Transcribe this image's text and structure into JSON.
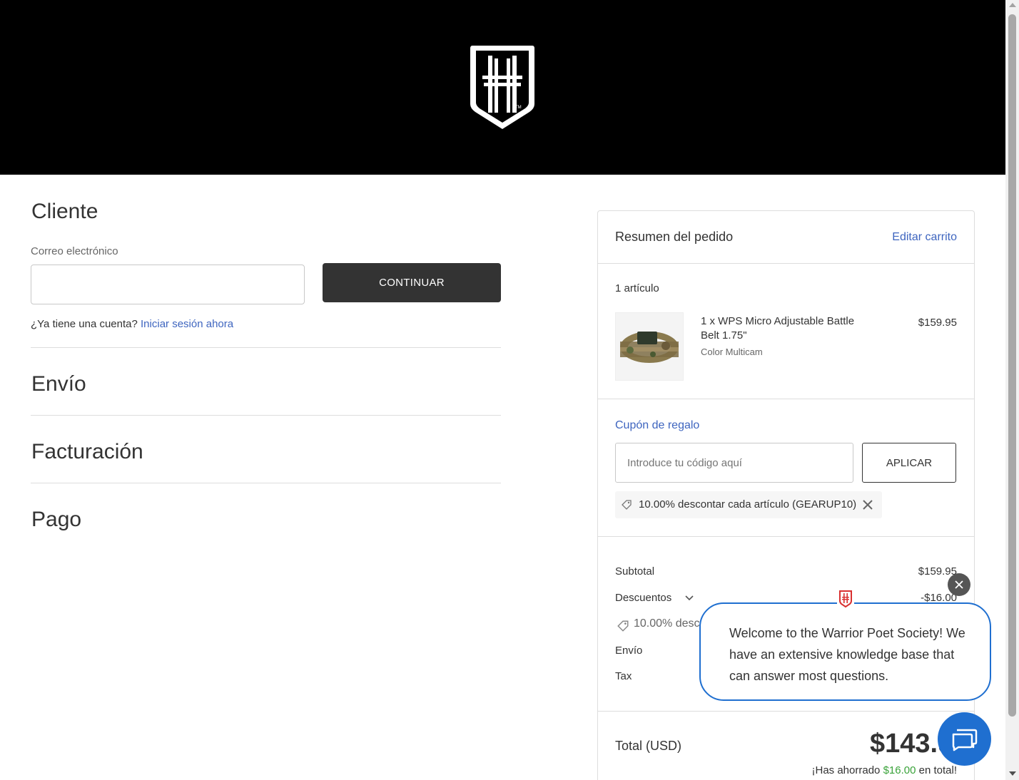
{
  "header": {
    "logo": "warrior-poet-shield-logo"
  },
  "customer": {
    "title": "Cliente",
    "email_label": "Correo electrónico",
    "email_value": "",
    "continue_label": "CONTINUAR",
    "account_question": "¿Ya tiene una cuenta?",
    "signin_link": "Iniciar sesión ahora"
  },
  "sections": {
    "shipping": "Envío",
    "billing": "Facturación",
    "payment": "Pago"
  },
  "summary": {
    "title": "Resumen del pedido",
    "edit_cart": "Editar carrito",
    "items_count": "1 artículo",
    "product": {
      "name": "1 x WPS Micro Adjustable Battle Belt 1.75\"",
      "option": "Color Multicam",
      "price": "$159.95"
    },
    "coupon": {
      "link": "Cupón de regalo",
      "placeholder": "Introduce tu código aquí",
      "apply_label": "APLICAR",
      "applied": "10.00% descontar cada artículo (GEARUP10)"
    },
    "subtotal_label": "Subtotal",
    "subtotal_value": "$159.95",
    "discounts_label": "Descuentos",
    "discounts_value": "-$16.00",
    "discount_line": "10.00% desc",
    "shipping_label": "Envío",
    "tax_label": "Tax",
    "total_label": "Total (USD)",
    "total_value": "$143.9",
    "saved_prefix": "¡Has ahorrado",
    "saved_amount": "$16.00",
    "saved_suffix": "en total!"
  },
  "chat": {
    "message": "Welcome to the Warrior Poet Society! We have an extensive knowledge base that can answer most questions.",
    "close_icon": "close-icon",
    "launcher_icon": "chat-bubbles-icon"
  },
  "colors": {
    "accent_link": "#3e65bf",
    "chat_blue": "#1f6fd0",
    "savings_green": "#3aa33a",
    "button_dark": "#333333"
  }
}
